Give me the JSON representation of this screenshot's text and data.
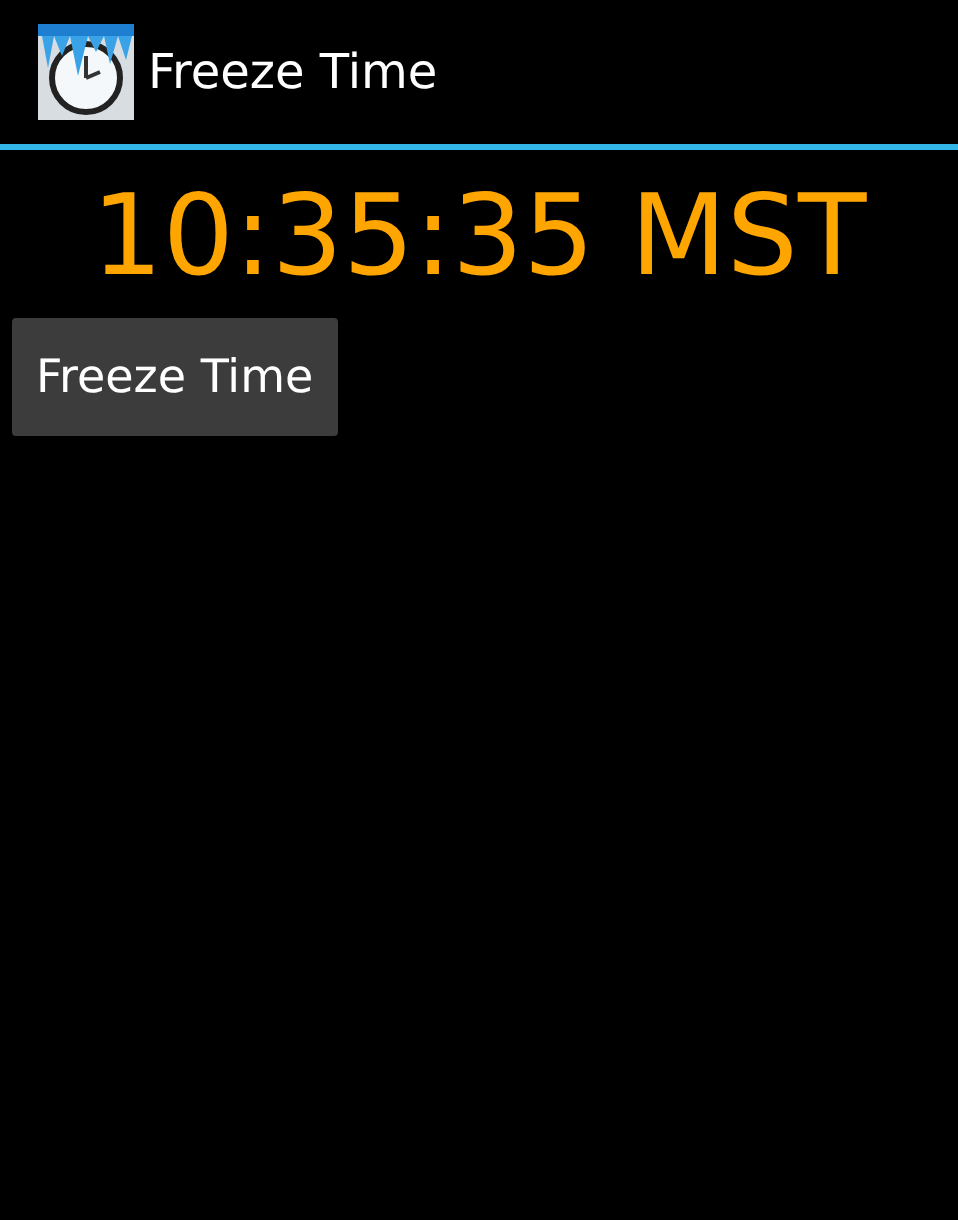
{
  "action_bar": {
    "title": "Freeze Time"
  },
  "clock": {
    "time": "10:35:35 MST"
  },
  "buttons": [
    "Freeze Time"
  ]
}
